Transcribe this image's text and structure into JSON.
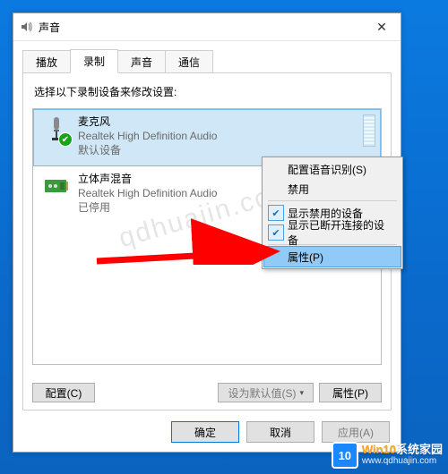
{
  "window": {
    "title": "声音",
    "close_glyph": "✕"
  },
  "tabs": {
    "t0": "播放",
    "t1": "录制",
    "t2": "声音",
    "t3": "通信"
  },
  "instruction": "选择以下录制设备来修改设置:",
  "devices": {
    "d0": {
      "name": "麦克风",
      "desc": "Realtek High Definition Audio",
      "status": "默认设备",
      "badge": "✔"
    },
    "d1": {
      "name": "立体声混音",
      "desc": "Realtek High Definition Audio",
      "status": "已停用"
    }
  },
  "buttons": {
    "configure": "配置(C)",
    "set_default": "设为默认值(S)",
    "properties": "属性(P)",
    "ok": "确定",
    "cancel": "取消",
    "apply": "应用(A)"
  },
  "context_menu": {
    "m0": "配置语音识别(S)",
    "m1": "禁用",
    "m2": "显示禁用的设备",
    "m3": "显示已断开连接的设备",
    "m4": "属性(P)",
    "check": "✔"
  },
  "watermark": {
    "center": "qdhuajin.com",
    "brand_num": "10",
    "brand_text_a": "Win10",
    "brand_text_b": "系统家园",
    "brand_url": "www.qdhuajin.com"
  }
}
